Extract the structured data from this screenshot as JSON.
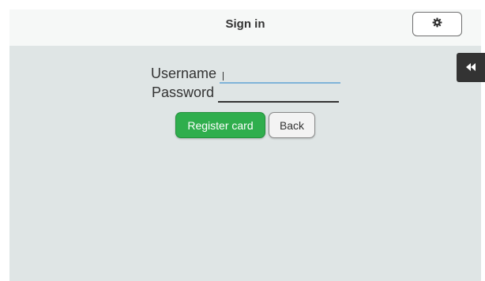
{
  "header": {
    "title": "Sign in",
    "settings_icon": "gear-icon"
  },
  "side_panel": {
    "toggle_icon": "double-chevron-left-icon"
  },
  "form": {
    "username_label": "Username",
    "username_value": "",
    "password_label": "Password",
    "password_value": "",
    "register_label": "Register card",
    "back_label": "Back"
  },
  "colors": {
    "header_bg": "#f6f8f7",
    "content_bg": "#dfe5e5",
    "accent_green": "#2fae4d",
    "focus_underline": "#7fb3d8",
    "dark": "#333333"
  }
}
